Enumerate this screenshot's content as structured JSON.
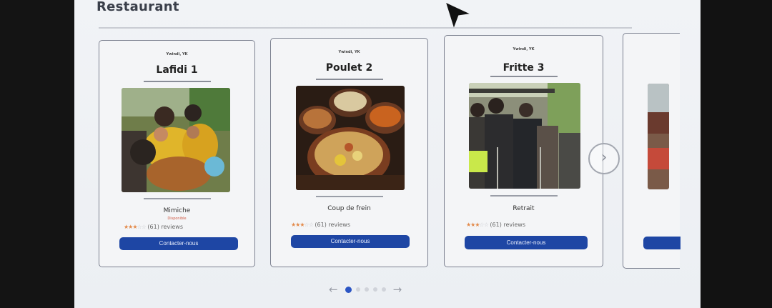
{
  "section": {
    "title": "Restaurant"
  },
  "cards": [
    {
      "tag": "Ywindi, YK",
      "name": "Lafidi 1",
      "owner": "Mimiche",
      "subowner": "Disponible",
      "reviews": "(61) reviews",
      "cta": "Contacter-nous",
      "rating": 3
    },
    {
      "tag": "Ywindi, YK",
      "name": "Poulet 2",
      "owner": "Coup de frein",
      "reviews": "(61) reviews",
      "cta": "Contacter-nous",
      "rating": 3
    },
    {
      "tag": "Ywindi, YK",
      "name": "Fritte 3",
      "owner": "Retrait",
      "reviews": "(61) reviews",
      "cta": "Contacter-nous",
      "rating": 3
    }
  ],
  "carousel": {
    "next_glyph": "›",
    "prev_arrow": "←",
    "next_arrow": "→",
    "pages": 5,
    "active_page": 1
  },
  "stars": {
    "on": "★★★",
    "off": "☆☆"
  },
  "colors": {
    "cta": "#1e46a4",
    "active_dot": "#2b55c4",
    "star": "#e38a4a"
  }
}
